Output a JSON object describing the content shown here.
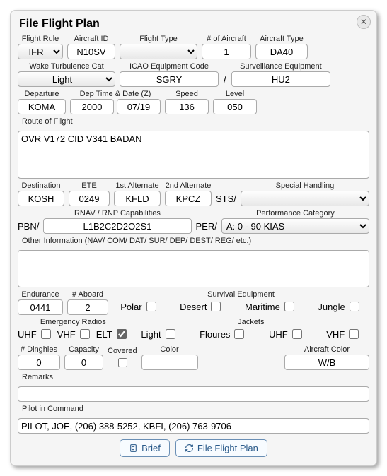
{
  "title": "File Flight Plan",
  "labels": {
    "flight_rule": "Flight Rule",
    "aircraft_id": "Aircraft ID",
    "flight_type": "Flight Type",
    "num_aircraft": "# of Aircraft",
    "aircraft_type": "Aircraft Type",
    "wake_cat": "Wake Turbulence Cat",
    "icao_equip": "ICAO Equipment Code",
    "surv_equip": "Surveillance Equipment",
    "departure": "Departure",
    "dep_time": "Dep Time & Date (Z)",
    "speed": "Speed",
    "level": "Level",
    "route": "Route of Flight",
    "destination": "Destination",
    "ete": "ETE",
    "alt1": "1st Alternate",
    "alt2": "2nd Alternate",
    "special": "Special Handling",
    "rnav": "RNAV / RNP Capabilities",
    "perf_cat": "Performance Category",
    "other_info": "Other Information (NAV/ COM/ DAT/ SUR/ DEP/ DEST/ REG/ etc.)",
    "endurance": "Endurance",
    "aboard": "# Aboard",
    "survival": "Survival Equipment",
    "emerg_radios": "Emergency Radios",
    "jackets": "Jackets",
    "dinghies": "# Dinghies",
    "capacity": "Capacity",
    "covered": "Covered",
    "color": "Color",
    "ac_color": "Aircraft Color",
    "remarks": "Remarks",
    "pic": "Pilot in Command"
  },
  "values": {
    "flight_rule": "IFR",
    "aircraft_id": "N10SV",
    "flight_type": "",
    "num_aircraft": "1",
    "aircraft_type": "DA40",
    "wake_cat": "Light",
    "icao_equip": "SGRY",
    "surv_equip": "HU2",
    "departure": "KOMA",
    "dep_time": "2000",
    "dep_date": "07/19",
    "speed": "136",
    "level": "050",
    "route": "OVR V172 CID V341 BADAN",
    "destination": "KOSH",
    "ete": "0249",
    "alt1": "KFLD",
    "alt2": "KPCZ",
    "sts_prefix": "STS/",
    "special": "",
    "pbn_prefix": "PBN/",
    "rnav": "L1B2C2D2O2S1",
    "per_prefix": "PER/",
    "perf_cat": "A: 0 - 90 KIAS",
    "other_info": "",
    "endurance": "0441",
    "aboard": "2",
    "dinghies": "0",
    "capacity": "0",
    "dinghy_color": "",
    "ac_color": "W/B",
    "remarks": "",
    "pic": "PILOT, JOE, (206) 388-5252, KBFI, (206) 763-9706"
  },
  "survival": {
    "polar": {
      "label": "Polar",
      "checked": false
    },
    "desert": {
      "label": "Desert",
      "checked": false
    },
    "maritime": {
      "label": "Maritime",
      "checked": false
    },
    "jungle": {
      "label": "Jungle",
      "checked": false
    }
  },
  "radios": {
    "uhf": {
      "label": "UHF",
      "checked": false
    },
    "vhf": {
      "label": "VHF",
      "checked": false
    },
    "elt": {
      "label": "ELT",
      "checked": true
    }
  },
  "jackets": {
    "light": {
      "label": "Light",
      "checked": false
    },
    "floures": {
      "label": "Floures",
      "checked": false
    },
    "uhf": {
      "label": "UHF",
      "checked": false
    },
    "vhf": {
      "label": "VHF",
      "checked": false
    }
  },
  "covered": false,
  "buttons": {
    "brief": "Brief",
    "file": "File Flight Plan"
  }
}
